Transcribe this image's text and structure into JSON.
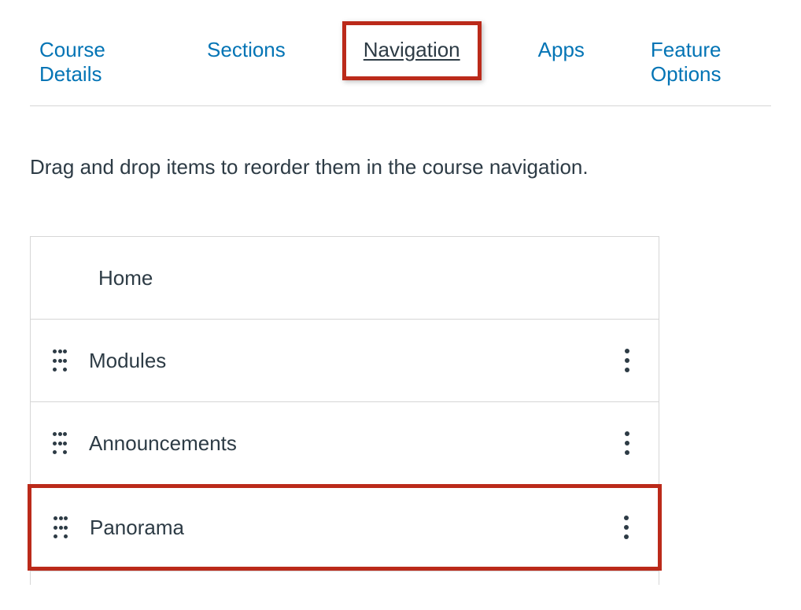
{
  "tabs": [
    {
      "id": "course-details",
      "label": "Course Details",
      "active": false
    },
    {
      "id": "sections",
      "label": "Sections",
      "active": false
    },
    {
      "id": "navigation",
      "label": "Navigation",
      "active": true
    },
    {
      "id": "apps",
      "label": "Apps",
      "active": false
    },
    {
      "id": "feature-options",
      "label": "Feature Options",
      "active": false
    }
  ],
  "instruction": "Drag and drop items to reorder them in the course navigation.",
  "nav_items": [
    {
      "label": "Home",
      "draggable": false,
      "has_menu": false
    },
    {
      "label": "Modules",
      "draggable": true,
      "has_menu": true
    },
    {
      "label": "Announcements",
      "draggable": true,
      "has_menu": true
    },
    {
      "label": "Panorama",
      "draggable": true,
      "has_menu": true,
      "highlighted": true
    }
  ]
}
